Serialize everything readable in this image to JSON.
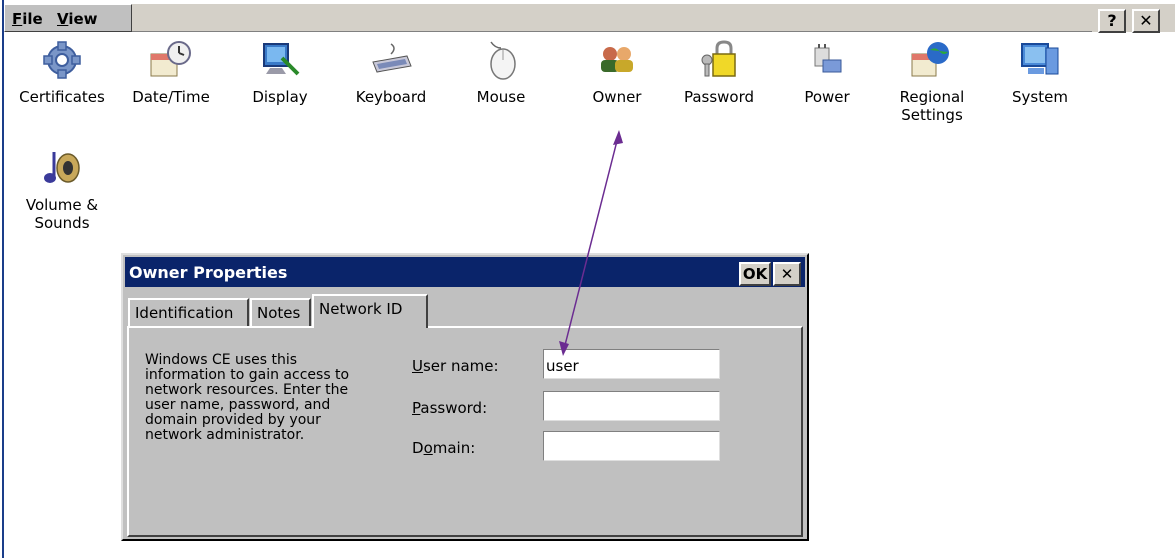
{
  "menubar": {
    "file_label": "File",
    "file_key": "F",
    "file_rest": "ile",
    "view_label": "View",
    "view_key": "V",
    "view_rest": "iew"
  },
  "title_buttons": {
    "help": "?",
    "close": "✕"
  },
  "icons": [
    {
      "label": "Certificates",
      "icon": "gear-icon"
    },
    {
      "label": "Date/Time",
      "icon": "calendar-clock-icon"
    },
    {
      "label": "Display",
      "icon": "display-icon"
    },
    {
      "label": "Keyboard",
      "icon": "keyboard-icon"
    },
    {
      "label": "Mouse",
      "icon": "mouse-icon"
    },
    {
      "label": "Owner",
      "icon": "owner-people-icon"
    },
    {
      "label": "Password",
      "icon": "password-lock-icon"
    },
    {
      "label": "Power",
      "icon": "power-plug-icon"
    },
    {
      "label": "Regional\nSettings",
      "icon": "globe-calendar-icon"
    },
    {
      "label": "System",
      "icon": "system-computer-icon"
    },
    {
      "label": "Volume &\nSounds",
      "icon": "music-speaker-icon"
    }
  ],
  "dialog": {
    "title": "Owner Properties",
    "ok_label": "OK",
    "close_label": "✕",
    "tabs": [
      "Identification",
      "Notes",
      "Network ID"
    ],
    "active_tab": "Network ID",
    "description": "Windows CE uses this\ninformation to gain access to\nnetwork resources. Enter the\nuser name, password, and\ndomain provided by your\nnetwork administrator.",
    "fields": {
      "username": {
        "label_key": "U",
        "label_rest": "ser name:",
        "value": "user"
      },
      "password": {
        "label_key": "P",
        "label_rest": "assword:",
        "value": ""
      },
      "domain": {
        "label_pre": "D",
        "label_key": "o",
        "label_rest": "main:",
        "value": ""
      }
    }
  },
  "colors": {
    "title_bar": "#0a246a",
    "dialog_face": "#c0c0c0",
    "annotation_arrow": "#6b2c91"
  }
}
